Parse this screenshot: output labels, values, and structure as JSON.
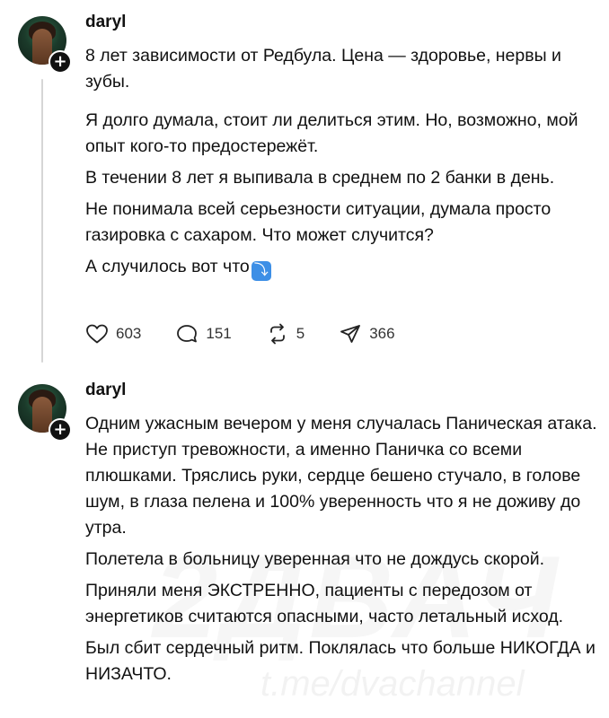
{
  "posts": [
    {
      "username": "daryl",
      "paragraphs": [
        "8 лет зависимости от Редбула. Цена — здоровье, нервы и зубы.",
        "Я долго думала, стоит ли делиться этим. Но, возможно, мой опыт кого-то предостережёт.",
        "В течении 8 лет я выпивала в среднем по 2 банки в день.",
        "Не понимала всей серьезности ситуации, думала просто газировка с сахаром. Что может случится?",
        "А случилось вот что"
      ],
      "emoji": "⤵",
      "stats": {
        "likes": "603",
        "comments": "151",
        "reposts": "5",
        "shares": "366"
      }
    },
    {
      "username": "daryl",
      "paragraphs": [
        "Одним ужасным вечером у меня случалась Паническая атака. Не приступ тревожности, а именно Паничка со всеми плюшками. Тряслись руки, сердце бешено стучало, в голове шум, в глаза пелена и 100% уверенность что я не доживу до утра.",
        "Полетела в больницу уверенная что не дождусь скорой.",
        "Приняли меня ЭКСТРЕННО, пациенты с передозом от энергетиков считаются опасными, часто летальный исход.",
        "Был сбит сердечный ритм. Поклялась что больше НИКОГДА и НИЗАЧТО."
      ]
    }
  ],
  "plus_symbol": "+",
  "icons": [
    "heart-icon",
    "comment-icon",
    "repost-icon",
    "share-icon",
    "plus-icon"
  ],
  "watermark": {
    "big": "2ДВАЧ",
    "small": "t.me/dvachannel"
  }
}
